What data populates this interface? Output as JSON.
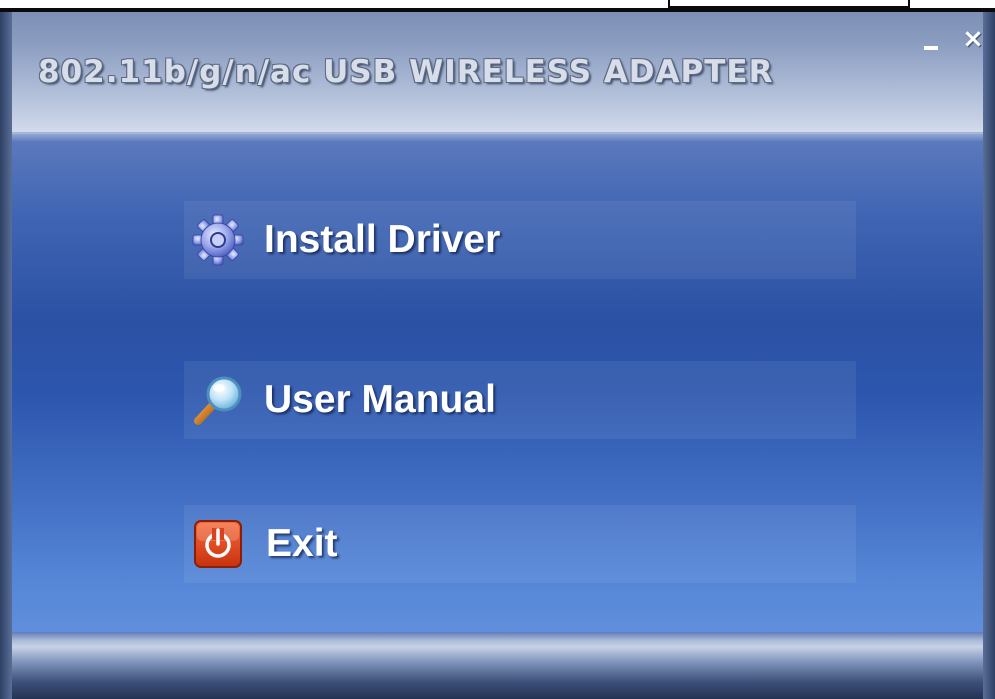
{
  "window": {
    "title": "802.11b/g/n/ac USB WIRELESS ADAPTER",
    "minimize_label": "minimize",
    "close_label": "×"
  },
  "menu": {
    "items": [
      {
        "label": "Install Driver",
        "icon": "gear-icon"
      },
      {
        "label": "User Manual",
        "icon": "magnifier-icon"
      },
      {
        "label": "Exit",
        "icon": "power-icon"
      }
    ]
  },
  "colors": {
    "background_blue": "#2b51a4",
    "title_bar": "#a6b5d2",
    "text": "#ffffff",
    "exit_icon": "#d8441c"
  }
}
